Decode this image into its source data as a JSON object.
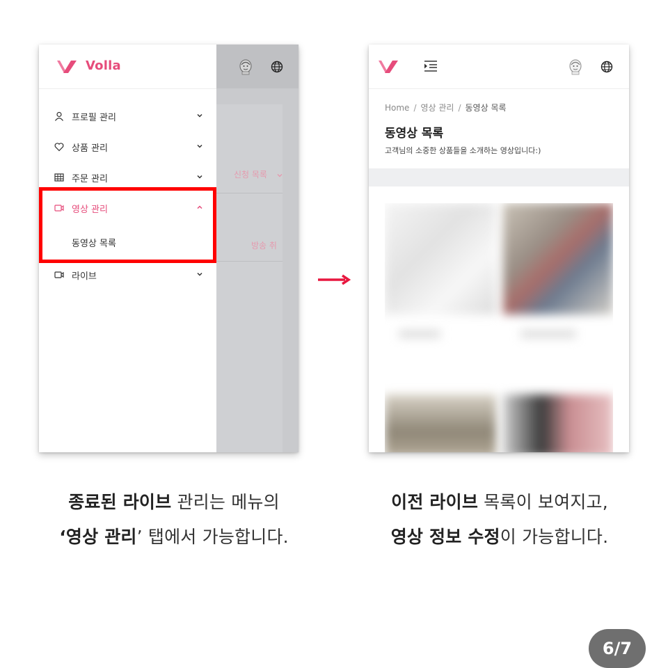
{
  "left_screen": {
    "brand": "Volla",
    "menu": [
      {
        "label": "프로필 관리",
        "icon": "user-icon",
        "expanded": false
      },
      {
        "label": "상품 관리",
        "icon": "heart-icon",
        "expanded": false
      },
      {
        "label": "주문 관리",
        "icon": "table-icon",
        "expanded": false
      },
      {
        "label": "영상 관리",
        "icon": "video-icon",
        "expanded": true,
        "active": true
      },
      {
        "label": "라이브",
        "icon": "video-icon",
        "expanded": false
      }
    ],
    "submenu_item": "동영상 목록",
    "background_texts": [
      "신청 목록",
      "방송 취"
    ]
  },
  "right_screen": {
    "breadcrumb": [
      "Home",
      "영상 관리",
      "동영상 목록"
    ],
    "title": "동영상 목록",
    "subtitle": "고객님의 소중한 상품들을 소개하는 영상입니다:)"
  },
  "captions": {
    "left_line1_bold": "종료된 라이브",
    "left_line1_rest": " 관리는 메뉴의",
    "left_line2_open": "‘",
    "left_line2_bold": "영상 관리",
    "left_line2_rest": "’ 탭에서 가능합니다.",
    "right_line1_bold": "이전 라이브",
    "right_line1_rest": " 목록이 보여지고,",
    "right_line2_bold": "영상 정보 수정",
    "right_line2_rest": "이 가능합니다."
  },
  "page_indicator": "6/7",
  "colors": {
    "brand": "#e64c7b",
    "highlight": "#ff0000",
    "arrow": "#e8173f",
    "badge": "#6f6f6f"
  }
}
